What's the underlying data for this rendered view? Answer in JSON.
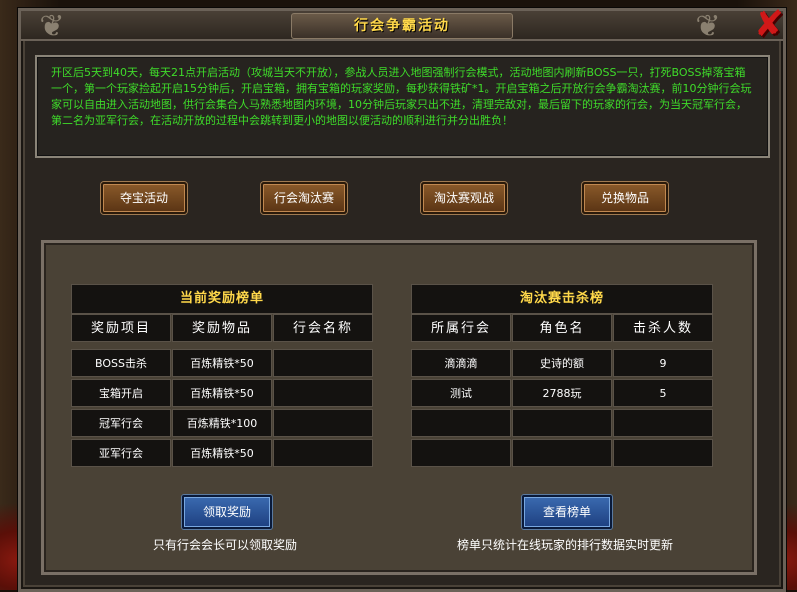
{
  "title": "行会争霸活动",
  "description": "开区后5天到40天，每天21点开启活动（攻城当天不开放），参战人员进入地图强制行会模式，活动地图内刷新BOSS一只，打死BOSS掉落宝箱一个，第一个玩家捡起开启15分钟后，开启宝箱，拥有宝箱的玩家奖励，每秒获得铁矿*1。开启宝箱之后开放行会争霸淘汰赛，前10分钟行会玩家可以自由进入活动地图，供行会集合人马熟悉地图内环境，10分钟后玩家只出不进，清理完敌对，最后留下的玩家的行会，为当天冠军行会，第二名为亚军行会，在活动开放的过程中会跳转到更小的地图以便活动的顺利进行并分出胜负！",
  "tabs": [
    "夺宝活动",
    "行会淘汰赛",
    "淘汰赛观战",
    "兑换物品"
  ],
  "reward_table": {
    "title": "当前奖励榜单",
    "headers": [
      "奖励项目",
      "奖励物品",
      "行会名称"
    ],
    "rows": [
      [
        "BOSS击杀",
        "百炼精铁*50",
        ""
      ],
      [
        "宝箱开启",
        "百炼精铁*50",
        ""
      ],
      [
        "冠军行会",
        "百炼精铁*100",
        ""
      ],
      [
        "亚军行会",
        "百炼精铁*50",
        ""
      ]
    ]
  },
  "kill_table": {
    "title": "淘汰赛击杀榜",
    "headers": [
      "所属行会",
      "角色名",
      "击杀人数"
    ],
    "rows": [
      [
        "滴滴滴",
        "史诗的额",
        "9"
      ],
      [
        "测试",
        "2788玩",
        "5"
      ],
      [
        "",
        "",
        ""
      ],
      [
        "",
        "",
        ""
      ]
    ]
  },
  "claim_button": "领取奖励",
  "claim_note": "只有行会会长可以领取奖励",
  "view_button": "查看榜单",
  "view_note": "榜单只统计在线玩家的排行数据实时更新",
  "icons": {
    "close": "close-x-icon",
    "dragon": "dragon-ornament-icon"
  },
  "colors": {
    "title": "#ffd84a",
    "description": "#3fdc2a",
    "close": "#d01818"
  }
}
